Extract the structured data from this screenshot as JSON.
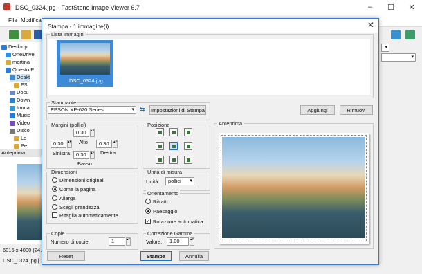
{
  "app": {
    "title": "DSC_0324.jpg  -  FastStone Image Viewer 6.7",
    "menu": [
      "File",
      "Modifica"
    ],
    "tree": [
      {
        "label": "Desktop",
        "indent": 0
      },
      {
        "label": "OneDrive",
        "indent": 1
      },
      {
        "label": "martina",
        "indent": 1
      },
      {
        "label": "Questo P",
        "indent": 1
      },
      {
        "label": "Deskt",
        "indent": 2
      },
      {
        "label": "FS",
        "indent": 3
      },
      {
        "label": "Docu",
        "indent": 2
      },
      {
        "label": "Down",
        "indent": 2
      },
      {
        "label": "Imma",
        "indent": 2
      },
      {
        "label": "Music",
        "indent": 2
      },
      {
        "label": "Video",
        "indent": 2
      },
      {
        "label": "Disco",
        "indent": 2
      },
      {
        "label": "Lo",
        "indent": 3
      },
      {
        "label": "Pe",
        "indent": 3
      }
    ],
    "preview_label": "Anteprima",
    "status_size": "6016 x 4000 (24.0",
    "status_file": "DSC_0324.jpg [ 1"
  },
  "dialog": {
    "title": "Stampa  -  1 immagine(i)",
    "image_list_label": "Lista Immagini",
    "image_name": "DSC_0324.jpg",
    "printer_label": "Stampante",
    "printer_value": "EPSON XP-620 Series",
    "printer_settings_btn": "Impostazioni di Stampa",
    "add_btn": "Aggiungi",
    "remove_btn": "Rimuovi",
    "margins": {
      "label": "Margini (pollici)",
      "top_value": "0.30",
      "top_label": "Alto",
      "left_value": "0.30",
      "left_label": "Sinistra",
      "right_value": "0.30",
      "right_label": "Destra",
      "bottom_value": "0.30",
      "bottom_label": "Basso"
    },
    "position_label": "Posizione",
    "dimensions": {
      "label": "Dimensioni",
      "options": [
        "Dimensioni originali",
        "Come la pagina",
        "Allarga",
        "Scegli grandezza"
      ],
      "selected": 1,
      "crop_label": "Ritaglia automaticamente"
    },
    "units": {
      "label": "Unità di misura",
      "field_label": "Unità:",
      "value": "pollici"
    },
    "orientation": {
      "label": "Orientamento",
      "options": [
        "Ritratto",
        "Paesaggio"
      ],
      "selected": 1,
      "auto_label": "Rotazione automatica",
      "auto_checked": true
    },
    "copies": {
      "label": "Copie",
      "field_label": "Numero di copie:",
      "value": "1"
    },
    "gamma": {
      "label": "Correzione Gamma",
      "field_label": "Valore:",
      "value": "1.00"
    },
    "preview_label": "Anteprima",
    "reset_btn": "Reset",
    "print_btn": "Stampa",
    "cancel_btn": "Annulla"
  }
}
